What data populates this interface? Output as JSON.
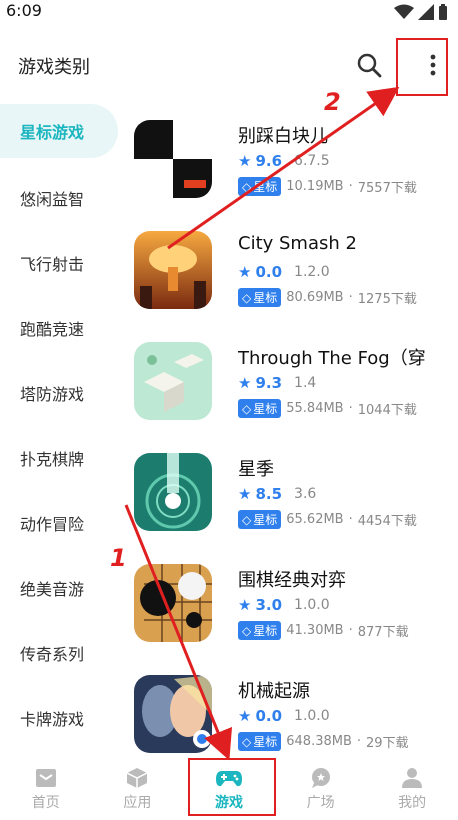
{
  "status_bar": {
    "time": "6:09"
  },
  "header": {
    "title": "游戏类别"
  },
  "sidebar": {
    "items": [
      {
        "label": "星标游戏",
        "active": true
      },
      {
        "label": "悠闲益智",
        "active": false
      },
      {
        "label": "飞行射击",
        "active": false
      },
      {
        "label": "跑酷竞速",
        "active": false
      },
      {
        "label": "塔防游戏",
        "active": false
      },
      {
        "label": "扑克棋牌",
        "active": false
      },
      {
        "label": "动作冒险",
        "active": false
      },
      {
        "label": "绝美音游",
        "active": false
      },
      {
        "label": "传奇系列",
        "active": false
      },
      {
        "label": "卡牌游戏",
        "active": false
      }
    ]
  },
  "games": [
    {
      "name": "别踩白块儿",
      "rating": "9.6",
      "version": "6.7.5",
      "badge": "星标",
      "size": "10.19MB",
      "downloads": "7557下载"
    },
    {
      "name": "City Smash 2",
      "rating": "0.0",
      "version": "1.2.0",
      "badge": "星标",
      "size": "80.69MB",
      "downloads": "1275下载"
    },
    {
      "name": "Through The Fog（穿",
      "rating": "9.3",
      "version": "1.4",
      "badge": "星标",
      "size": "55.84MB",
      "downloads": "1044下载"
    },
    {
      "name": "星季",
      "rating": "8.5",
      "version": "3.6",
      "badge": "星标",
      "size": "65.62MB",
      "downloads": "4454下载"
    },
    {
      "name": "围棋经典对弈",
      "rating": "3.0",
      "version": "1.0.0",
      "badge": "星标",
      "size": "41.30MB",
      "downloads": "877下载"
    },
    {
      "name": "机械起源",
      "rating": "0.0",
      "version": "1.0.0",
      "badge": "星标",
      "size": "648.38MB",
      "downloads": "29下载"
    }
  ],
  "bottom_nav": {
    "items": [
      {
        "label": "首页",
        "icon": "home-icon"
      },
      {
        "label": "应用",
        "icon": "cube-icon"
      },
      {
        "label": "游戏",
        "icon": "gamepad-icon",
        "active": true
      },
      {
        "label": "广场",
        "icon": "chat-bubble-icon"
      },
      {
        "label": "我的",
        "icon": "person-icon"
      }
    ]
  },
  "annotations": {
    "step1": "1",
    "step2": "2",
    "color": "#e02020"
  },
  "colors": {
    "accent": "#1bb6bf",
    "rating_blue": "#2f80ed"
  }
}
